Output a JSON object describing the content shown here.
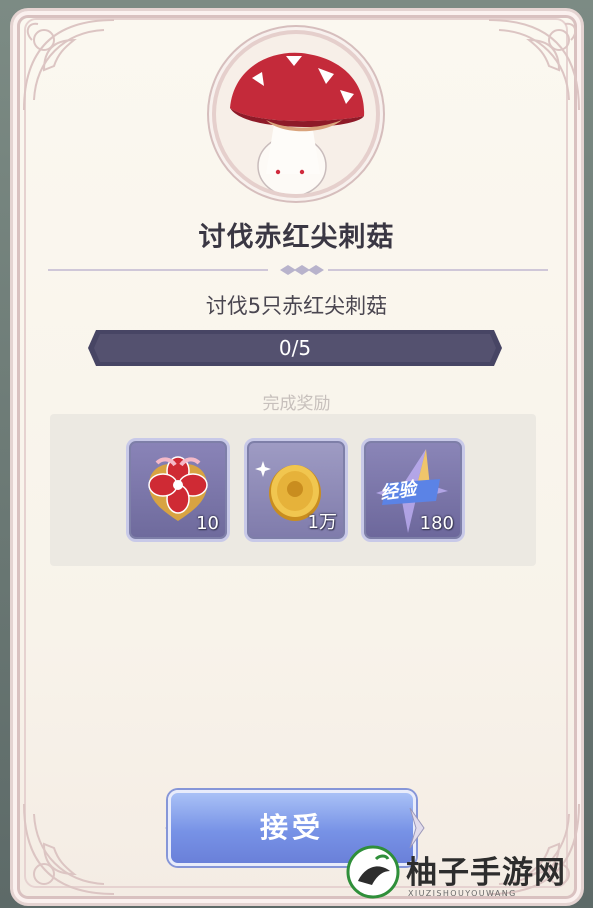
{
  "quest": {
    "title": "讨伐赤红尖刺菇",
    "task": "讨伐5只赤红尖刺菇",
    "progress_text": "0/5",
    "progress_value": 0,
    "progress_max": 5
  },
  "rewards": {
    "title": "完成奖励",
    "items": [
      {
        "icon": "cherry-blossom-emblem-icon",
        "count": "10"
      },
      {
        "icon": "gold-coin-icon",
        "count": "1万"
      },
      {
        "icon": "exp-crystal-icon",
        "label": "经验",
        "count": "180"
      }
    ]
  },
  "accept_label": "接受",
  "watermark": {
    "text": "柚子手游网",
    "sub": "XIUZISHOUYOUWANG"
  },
  "colors": {
    "accent": "#7792e6",
    "progress_bar": "#474564",
    "card_bg": "#fbf8f0",
    "frame": "#e4d3d1"
  }
}
